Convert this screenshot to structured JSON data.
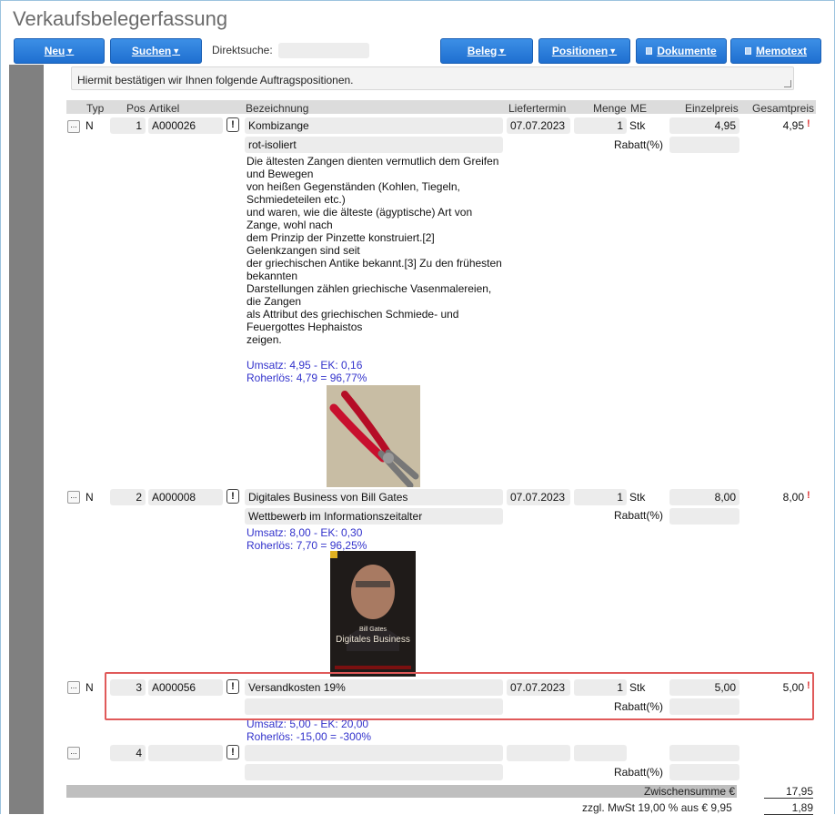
{
  "window_title": "Verkaufsbelegerfassung",
  "toolbar": {
    "neu": "Neu",
    "suchen": "Suchen",
    "direktsuche_label": "Direktsuche:",
    "direktsuche_value": "",
    "beleg": "Beleg",
    "positionen": "Positionen",
    "dokumente": "Dokumente",
    "memotext": "Memotext"
  },
  "memo_text": "Hiermit bestätigen wir Ihnen folgende Auftragspositionen.",
  "columns": {
    "typ": "Typ",
    "pos": "Pos",
    "artikel": "Artikel",
    "bezeichnung": "Bezeichnung",
    "liefertermin": "Liefertermin",
    "menge": "Menge",
    "me": "ME",
    "einzelpreis": "Einzelpreis",
    "gesamtpreis": "Gesamtpreis"
  },
  "rows": [
    {
      "typ": "N",
      "pos": "1",
      "artikel": "A000026",
      "bezeichnung": "Kombizange",
      "bezeichnung2": "rot-isoliert",
      "liefertermin": "07.07.2023",
      "menge": "1",
      "me": "Stk",
      "einzelpreis": "4,95",
      "gesamtpreis": "4,95",
      "rabatt_label": "Rabatt(%)",
      "description": [
        "Die ältesten Zangen dienten vermutlich dem Greifen",
        "und Bewegen",
        "von heißen Gegenständen (Kohlen, Tiegeln,",
        "Schmiedeteilen etc.)",
        "und waren, wie die älteste (ägyptische) Art von",
        "Zange, wohl nach",
        "dem Prinzip der Pinzette konstruiert.[2]",
        "Gelenkzangen sind seit",
        "der griechischen Antike bekannt.[3] Zu den frühesten",
        "bekannten",
        "Darstellungen zählen griechische Vasenmalereien,",
        "die Zangen",
        "als Attribut des griechischen Schmiede- und",
        "Feuergottes Hephaistos",
        "zeigen."
      ],
      "umsatz": "Umsatz: 4,95 - EK: 0,16",
      "rohertrag": "Roherlös: 4,79 = 96,77%"
    },
    {
      "typ": "N",
      "pos": "2",
      "artikel": "A000008",
      "bezeichnung": "Digitales Business von Bill Gates",
      "bezeichnung2": "Wettbewerb im Informationszeitalter",
      "liefertermin": "07.07.2023",
      "menge": "1",
      "me": "Stk",
      "einzelpreis": "8,00",
      "gesamtpreis": "8,00",
      "rabatt_label": "Rabatt(%)",
      "umsatz": "Umsatz: 8,00 - EK: 0,30",
      "rohertrag": "Roherlös: 7,70 = 96,25%",
      "book_author": "Bill Gates",
      "book_title": "Digitales Business"
    },
    {
      "typ": "N",
      "pos": "3",
      "artikel": "A000056",
      "bezeichnung": "Versandkosten 19%",
      "bezeichnung2": "",
      "liefertermin": "07.07.2023",
      "menge": "1",
      "me": "Stk",
      "einzelpreis": "5,00",
      "gesamtpreis": "5,00",
      "rabatt_label": "Rabatt(%)",
      "umsatz": "Umsatz: 5,00 - EK: 20,00",
      "rohertrag": "Roherlös: -15,00 = -300%"
    },
    {
      "typ": "",
      "pos": "4",
      "artikel": "",
      "bezeichnung": "",
      "bezeichnung2": "",
      "liefertermin": "",
      "menge": "",
      "me": "",
      "einzelpreis": "",
      "gesamtpreis": "",
      "rabatt_label": "Rabatt(%)"
    }
  ],
  "totals": {
    "zwischensumme_label": "Zwischensumme €",
    "zwischensumme": "17,95",
    "mwst_label": "zzgl. MwSt 19,00 % aus € 9,95",
    "mwst": "1,89"
  },
  "colors": {
    "button": "#1f6fd0",
    "highlight": "#e05a5a",
    "info_text": "#3333cc"
  }
}
